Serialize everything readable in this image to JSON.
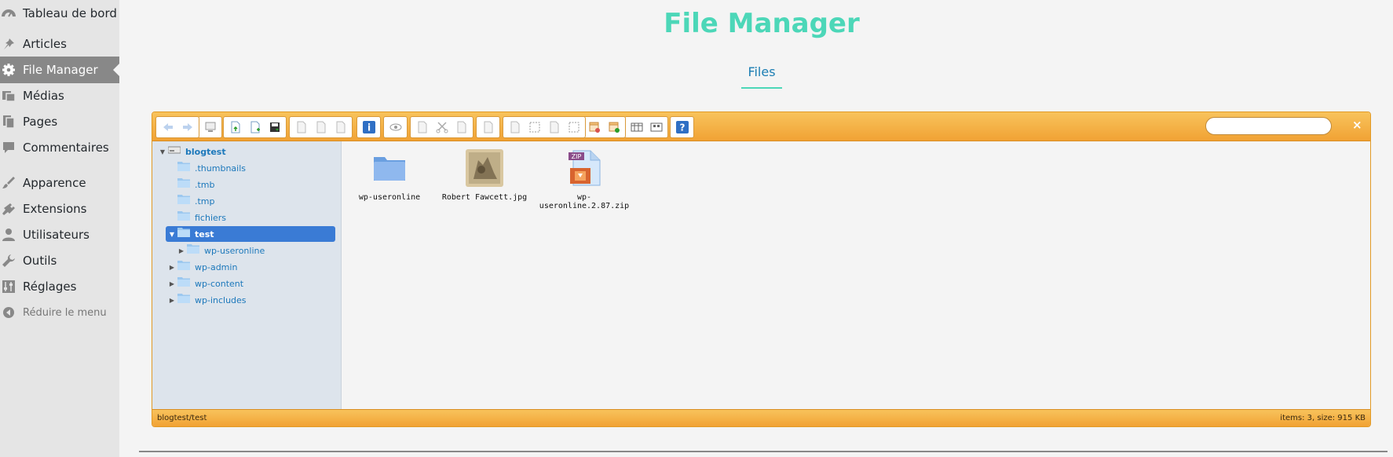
{
  "sidebar": {
    "items": [
      {
        "label": "Tableau de bord",
        "icon": "dashboard-icon"
      },
      {
        "label": "Articles",
        "icon": "pushpin-icon"
      },
      {
        "label": "File Manager",
        "icon": "gear-icon",
        "current": true
      },
      {
        "label": "Médias",
        "icon": "media-icon"
      },
      {
        "label": "Pages",
        "icon": "pages-icon"
      },
      {
        "label": "Commentaires",
        "icon": "comment-icon"
      },
      {
        "label": "Apparence",
        "icon": "brush-icon"
      },
      {
        "label": "Extensions",
        "icon": "plugin-icon"
      },
      {
        "label": "Utilisateurs",
        "icon": "user-icon"
      },
      {
        "label": "Outils",
        "icon": "wrench-icon"
      },
      {
        "label": "Réglages",
        "icon": "settings-sliders-icon"
      },
      {
        "label": "Réduire le menu",
        "icon": "collapse-arrow-icon"
      }
    ]
  },
  "header": {
    "title": "File Manager",
    "tab": "Files"
  },
  "file_manager": {
    "toolbar_groups": [
      [
        "back-icon",
        "forward-icon"
      ],
      [
        "home-computer-icon"
      ],
      [
        "upload-icon",
        "new-file-icon",
        "save-icon"
      ],
      [
        "open-icon",
        "download-icon",
        "select-icon"
      ],
      [
        "info-icon"
      ],
      [
        "preview-eye-icon"
      ],
      [
        "copy-icon",
        "cut-icon",
        "paste-icon"
      ],
      [
        "rename-icon"
      ],
      [
        "duplicate-icon",
        "select-all-icon",
        "edit-icon",
        "resize-icon"
      ],
      [
        "extract-icon",
        "archive-icon"
      ],
      [
        "list-view-icon",
        "icon-view-icon"
      ],
      [
        "help-icon"
      ]
    ],
    "search": {
      "value": "",
      "close": "×"
    },
    "tree": [
      {
        "label": "blogtest",
        "depth": 0,
        "arrow": "down",
        "root": true
      },
      {
        "label": ".thumbnails",
        "depth": 1,
        "arrow": ""
      },
      {
        "label": ".tmb",
        "depth": 1,
        "arrow": ""
      },
      {
        "label": ".tmp",
        "depth": 1,
        "arrow": ""
      },
      {
        "label": "fichiers",
        "depth": 1,
        "arrow": ""
      },
      {
        "label": "test",
        "depth": 1,
        "arrow": "down",
        "selected": true
      },
      {
        "label": "wp-useronline",
        "depth": 2,
        "arrow": "right"
      },
      {
        "label": "wp-admin",
        "depth": 1,
        "arrow": "right"
      },
      {
        "label": "wp-content",
        "depth": 1,
        "arrow": "right"
      },
      {
        "label": "wp-includes",
        "depth": 1,
        "arrow": "right"
      }
    ],
    "files": [
      {
        "name": "wp-useronline",
        "kind": "folder"
      },
      {
        "name": "Robert Fawcett.jpg",
        "kind": "image"
      },
      {
        "name": "wp-useronline.2.87.zip",
        "kind": "zip"
      }
    ],
    "status": {
      "path": "blogtest/test",
      "info": "items: 3, size: 915 KB"
    }
  },
  "colors": {
    "accent": "#4cd7b8",
    "toolbar": "#f1a234",
    "selection": "#3a7bd5",
    "link": "#1c78bb"
  }
}
